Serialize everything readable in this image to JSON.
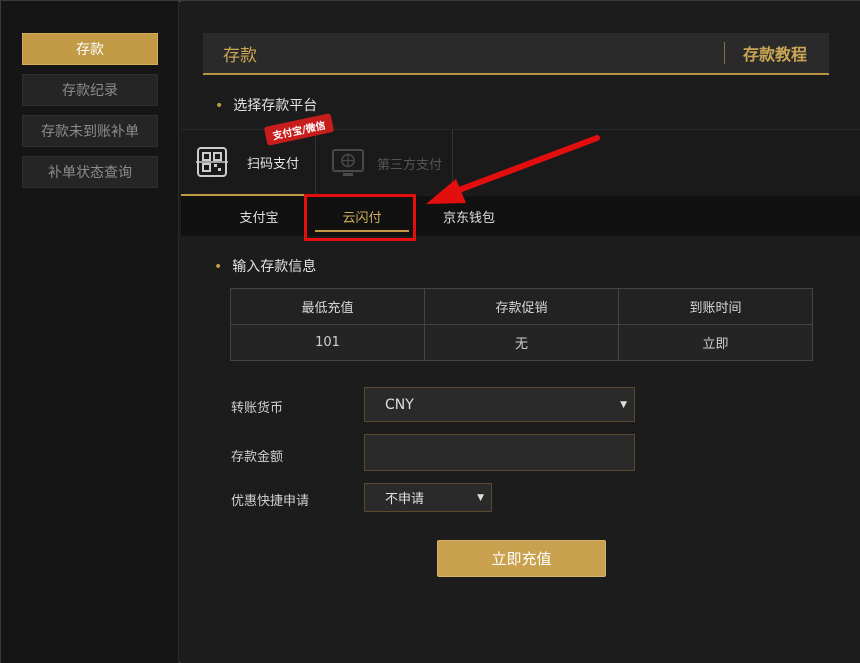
{
  "sidebar": {
    "items": [
      {
        "label": "存款"
      },
      {
        "label": "存款纪录"
      },
      {
        "label": "存款未到账补单"
      },
      {
        "label": "补单状态查询"
      }
    ]
  },
  "header": {
    "title": "存款",
    "tutorial_link": "存款教程"
  },
  "platform": {
    "section_title": "选择存款平台",
    "options": [
      {
        "label": "扫码支付",
        "badge": "支付宝/微信"
      },
      {
        "label": "第三方支付"
      }
    ]
  },
  "subtabs": [
    {
      "label": "支付宝"
    },
    {
      "label": "云闪付"
    },
    {
      "label": "京东钱包"
    }
  ],
  "deposit_info": {
    "section_title": "输入存款信息",
    "headers": [
      "最低充值",
      "存款促销",
      "到账时间"
    ],
    "row": [
      "101",
      "无",
      "立即"
    ]
  },
  "form": {
    "currency_label": "转账货币",
    "currency_value": "CNY",
    "amount_label": "存款金额",
    "amount_value": "",
    "promo_label": "优惠快捷申请",
    "promo_value": "不申请",
    "submit_label": "立即充值"
  },
  "colors": {
    "accent": "#c29a45",
    "annotation": "#e30f0f"
  }
}
